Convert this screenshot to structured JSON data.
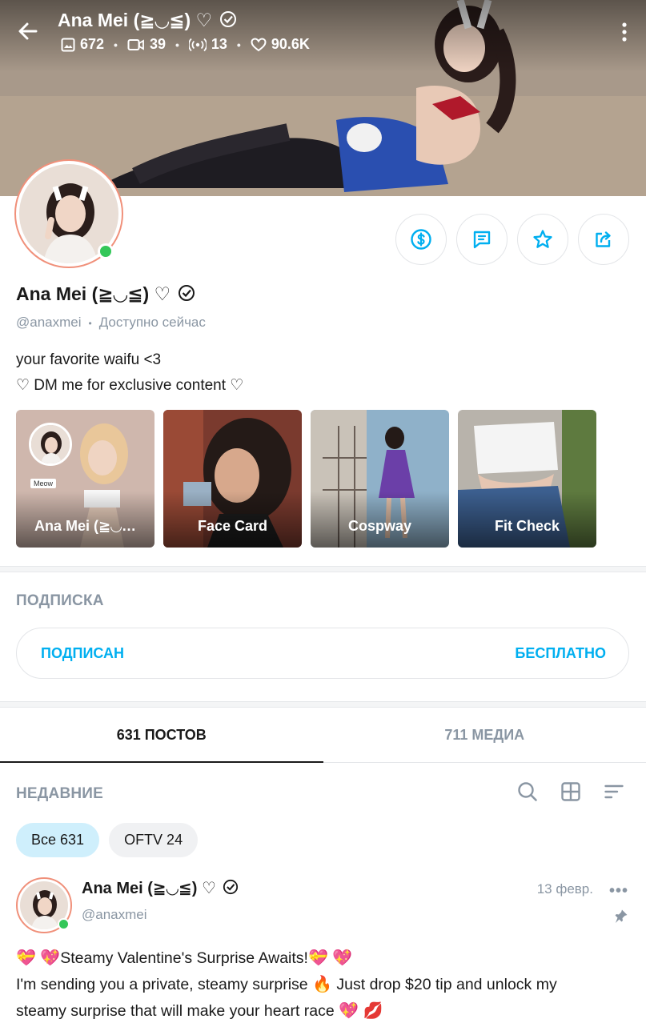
{
  "header": {
    "title": "Ana Mei (≧◡≦) ♡",
    "stats": [
      {
        "icon": "image-icon",
        "value": "672"
      },
      {
        "icon": "video-icon",
        "value": "39"
      },
      {
        "icon": "live-icon",
        "value": "13"
      },
      {
        "icon": "heart-icon",
        "value": "90.6K"
      }
    ]
  },
  "profile": {
    "name": "Ana Mei (≧◡≦) ♡",
    "handle": "@anaxmei",
    "status": "Доступно сейчас",
    "bio_line1": "your favorite waifu <3",
    "bio_line2": "♡ DM me for exclusive content ♡"
  },
  "highlights": [
    {
      "label": "Ana Mei (≧◡…",
      "badge": "Meow"
    },
    {
      "label": "Face Card"
    },
    {
      "label": "Cospway"
    },
    {
      "label": "Fit Check"
    }
  ],
  "subscription": {
    "title": "ПОДПИСКА",
    "status": "ПОДПИСАН",
    "price": "БЕСПЛАТНО"
  },
  "tabs": [
    {
      "label": "631 ПОСТОВ",
      "active": true
    },
    {
      "label": "711 МЕДИА",
      "active": false
    }
  ],
  "feed": {
    "title": "НЕДАВНИЕ",
    "chips": [
      {
        "label": "Все 631",
        "active": true
      },
      {
        "label": "OFTV 24",
        "active": false
      }
    ]
  },
  "post": {
    "name": "Ana Mei (≧◡≦) ♡",
    "handle": "@anaxmei",
    "date": "13 февр.",
    "more": "•••",
    "line1": "Steamy Valentine's Surprise Awaits!",
    "line2": "I'm sending you a private, steamy surprise",
    "line2b": "Just drop $20 tip and unlock my",
    "line3": "steamy surprise that will make your heart race"
  },
  "colors": {
    "accent": "#00aff0",
    "muted": "#8a96a3",
    "online": "#34c759",
    "avatar_ring": "#f0907a"
  }
}
